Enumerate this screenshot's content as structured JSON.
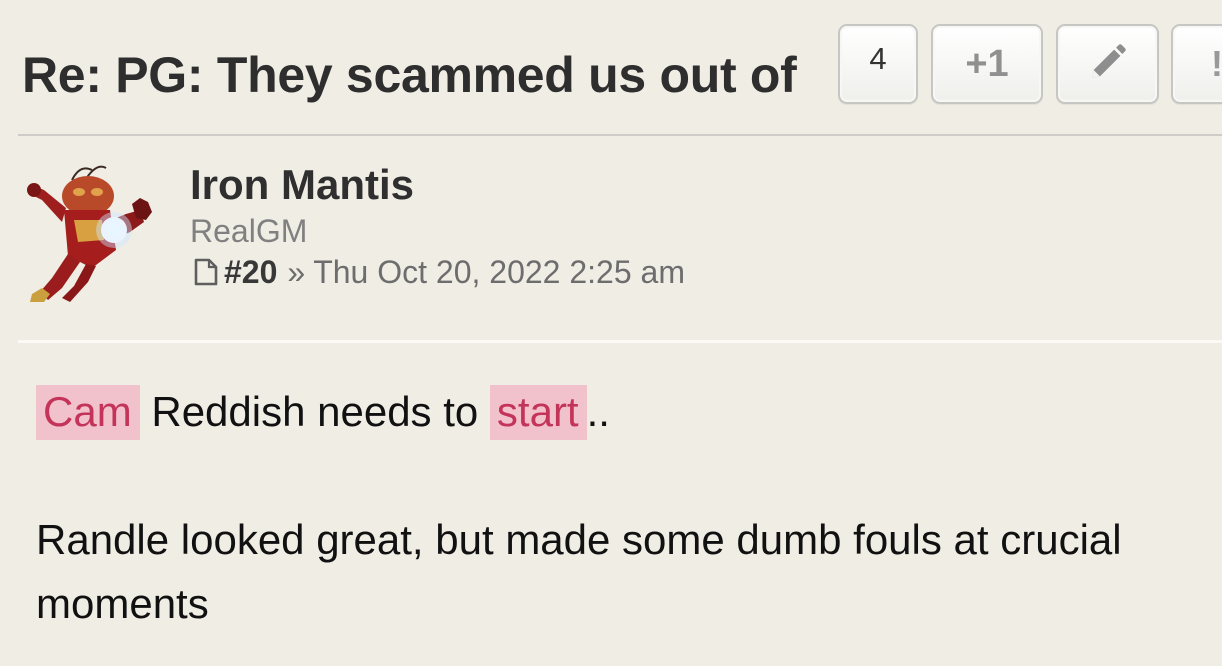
{
  "post": {
    "title": "Re: PG: They scammed us out of",
    "actions": {
      "count": "4",
      "plus_one": "+1",
      "edit_icon": "pencil-icon",
      "more_label": "!"
    },
    "author": {
      "name": "Iron Mantis",
      "rank": "RealGM",
      "avatar_icon": "iron-man-avatar"
    },
    "meta": {
      "post_icon": "document-icon",
      "number": "#20",
      "separator": "»",
      "datetime": "Thu Oct 20, 2022 2:25 am"
    },
    "body": {
      "line1": {
        "highlight1": "Cam",
        "text_mid": " Reddish needs to ",
        "highlight2": "start",
        "text_end": ".."
      },
      "paragraph2": "Randle looked great, but made some dumb fouls at crucial moments"
    },
    "colors": {
      "background": "#f0ede5",
      "highlight_bg": "#f1c2cc",
      "highlight_text": "#c4335a"
    }
  }
}
